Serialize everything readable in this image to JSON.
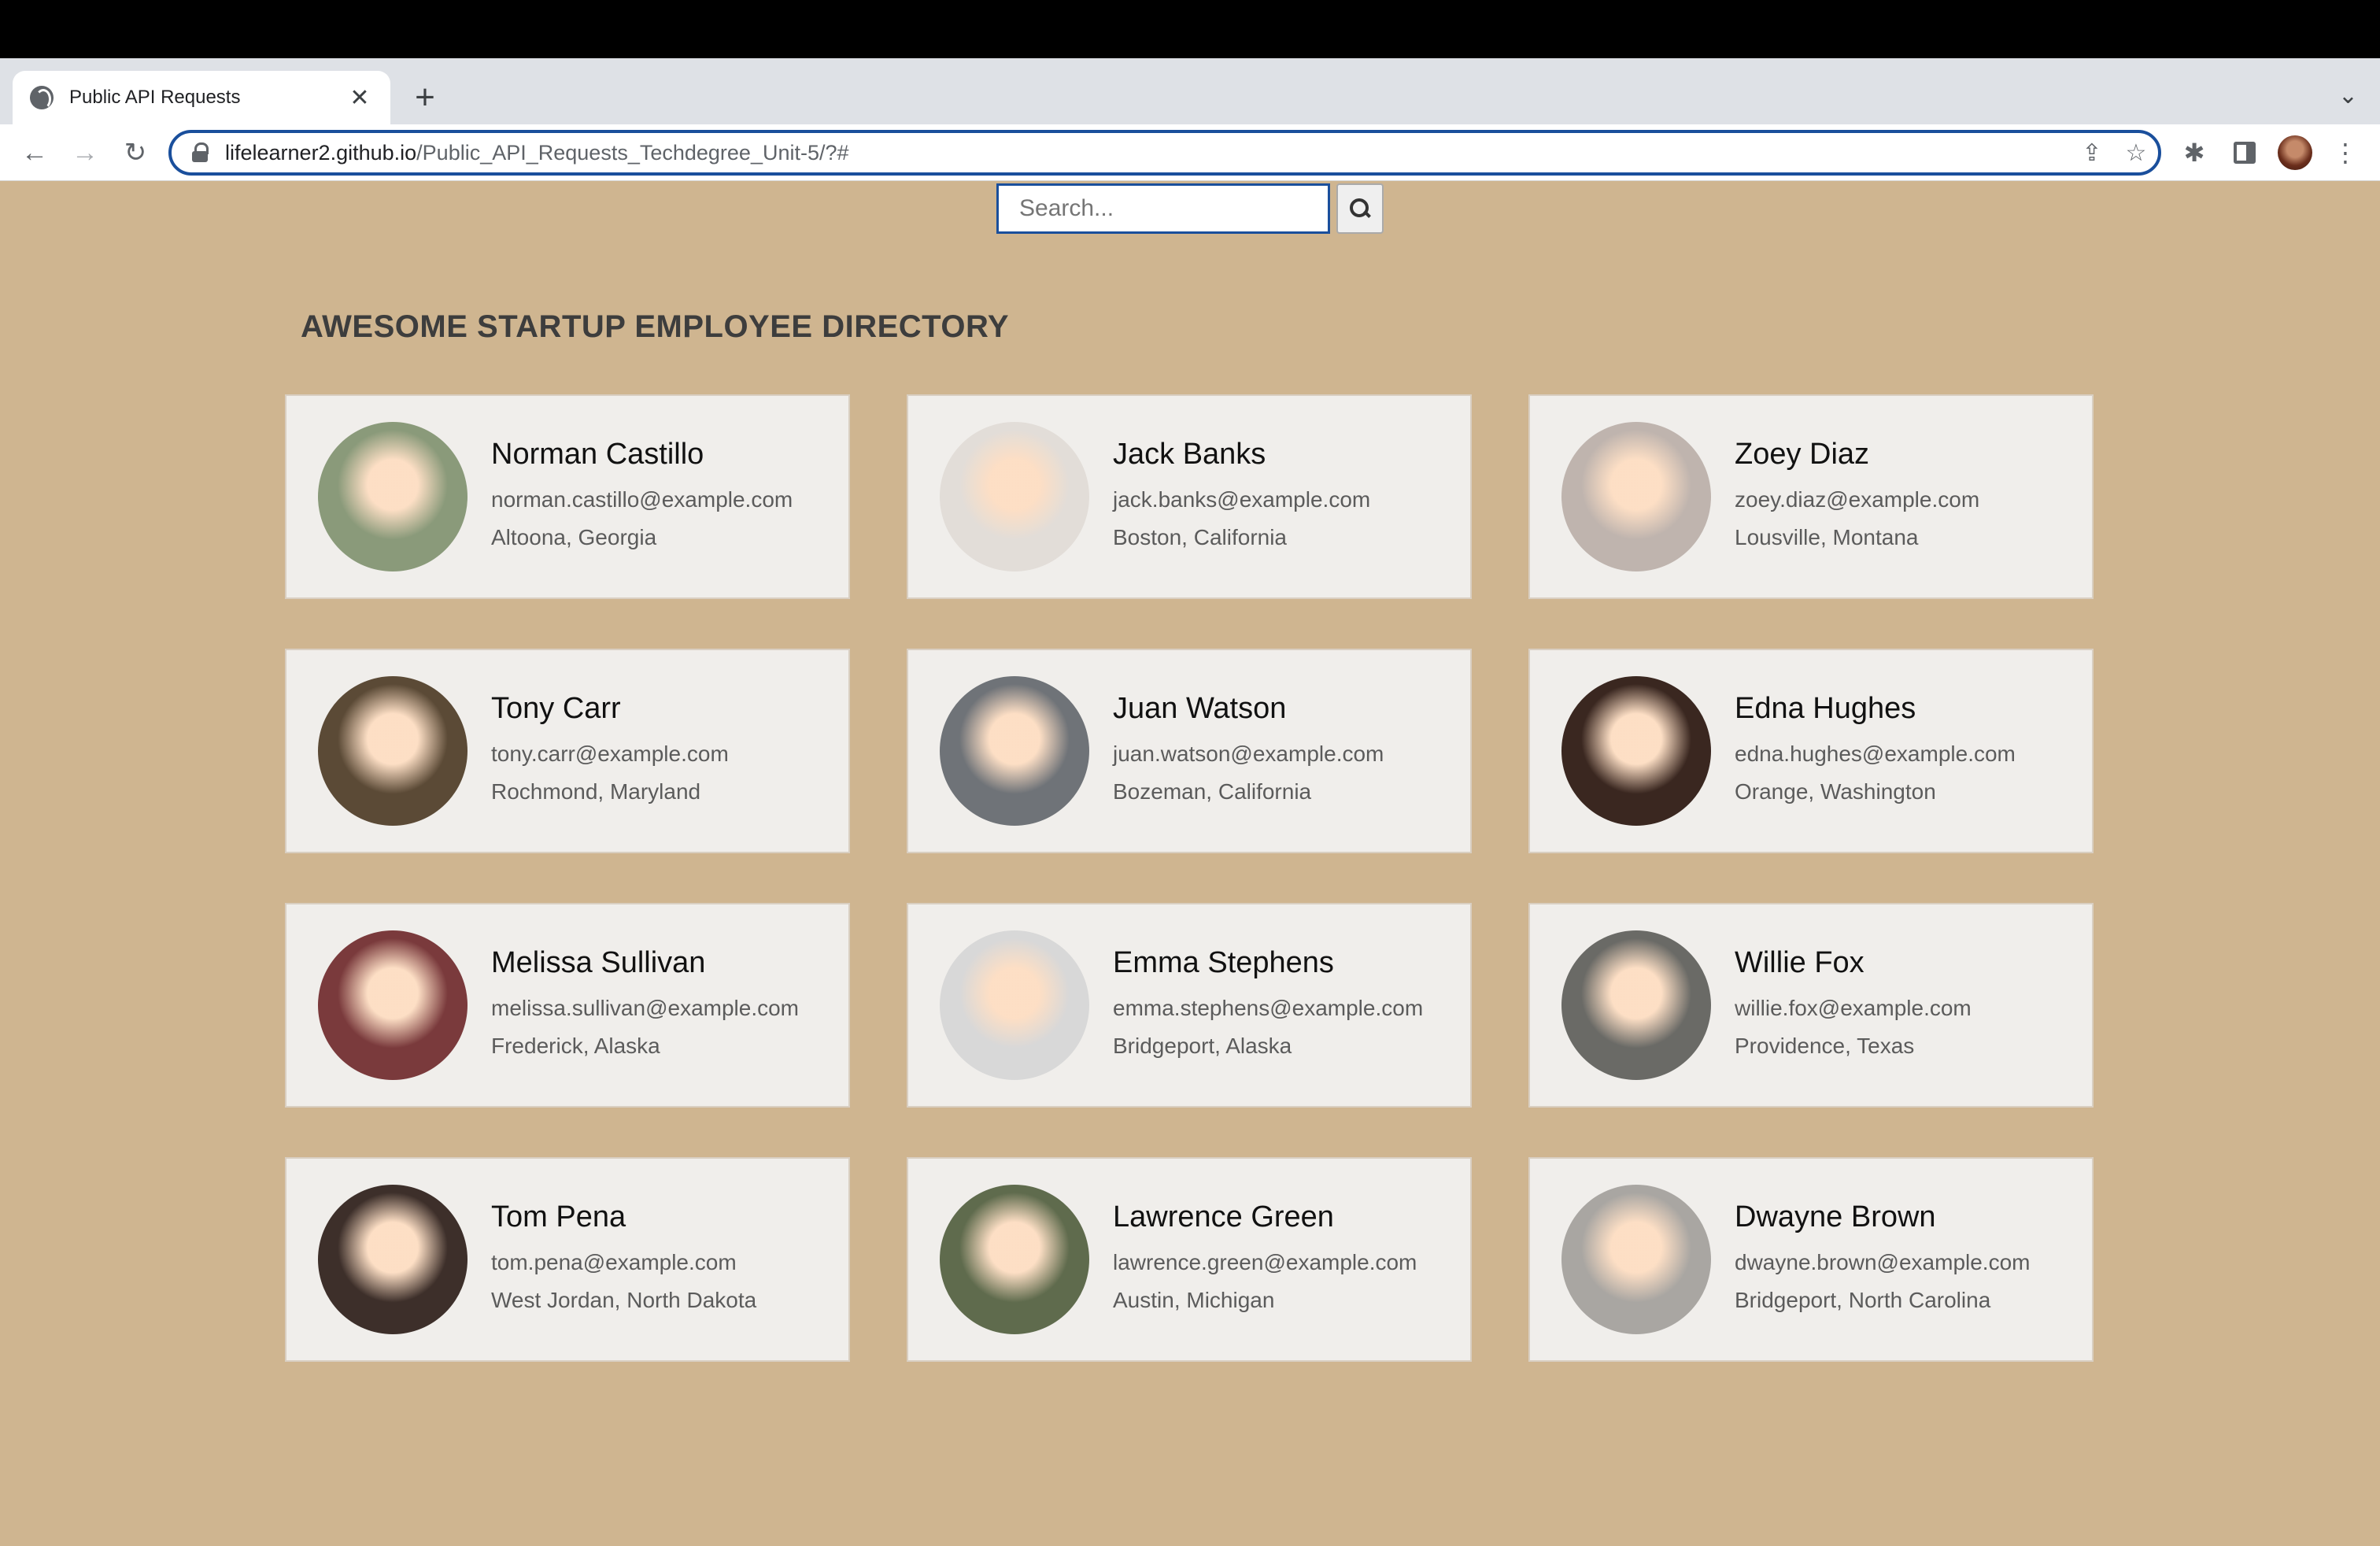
{
  "browser": {
    "tab_title": "Public API Requests",
    "tab_close": "✕",
    "new_tab": "+",
    "tab_list": "⌄",
    "url_host": "lifelearner2.github.io",
    "url_path": "/Public_API_Requests_Techdegree_Unit-5/?#",
    "icons": {
      "back": "←",
      "forward": "→",
      "reload": "↻",
      "share": "⇪",
      "star": "☆",
      "extensions": "✱",
      "menu": "⋮"
    }
  },
  "search": {
    "placeholder": "Search..."
  },
  "page": {
    "heading": "AWESOME STARTUP EMPLOYEE DIRECTORY"
  },
  "colors": {
    "page_background": "#cfb590",
    "card_background": "#f0eeeb",
    "focus_ring": "#1a4f9c"
  },
  "employees": [
    {
      "name": "Norman Castillo",
      "email": "norman.castillo@example.com",
      "location": "Altoona, Georgia",
      "avatar_color": "#8a9a7a"
    },
    {
      "name": "Jack Banks",
      "email": "jack.banks@example.com",
      "location": "Boston, California",
      "avatar_color": "#e2ddd8"
    },
    {
      "name": "Zoey Diaz",
      "email": "zoey.diaz@example.com",
      "location": "Lousville, Montana",
      "avatar_color": "#bfb4ae"
    },
    {
      "name": "Tony Carr",
      "email": "tony.carr@example.com",
      "location": "Rochmond, Maryland",
      "avatar_color": "#5b4a36"
    },
    {
      "name": "Juan Watson",
      "email": "juan.watson@example.com",
      "location": "Bozeman, California",
      "avatar_color": "#6f7378"
    },
    {
      "name": "Edna Hughes",
      "email": "edna.hughes@example.com",
      "location": "Orange, Washington",
      "avatar_color": "#3a2720"
    },
    {
      "name": "Melissa Sullivan",
      "email": "melissa.sullivan@example.com",
      "location": "Frederick, Alaska",
      "avatar_color": "#7a3a3c"
    },
    {
      "name": "Emma Stephens",
      "email": "emma.stephens@example.com",
      "location": "Bridgeport, Alaska",
      "avatar_color": "#d8d8d8"
    },
    {
      "name": "Willie Fox",
      "email": "willie.fox@example.com",
      "location": "Providence, Texas",
      "avatar_color": "#6a6a66"
    },
    {
      "name": "Tom Pena",
      "email": "tom.pena@example.com",
      "location": "West Jordan, North Dakota",
      "avatar_color": "#3d2f2a"
    },
    {
      "name": "Lawrence Green",
      "email": "lawrence.green@example.com",
      "location": "Austin, Michigan",
      "avatar_color": "#5f6b4d"
    },
    {
      "name": "Dwayne Brown",
      "email": "dwayne.brown@example.com",
      "location": "Bridgeport, North Carolina",
      "avatar_color": "#a9a6a2"
    }
  ]
}
